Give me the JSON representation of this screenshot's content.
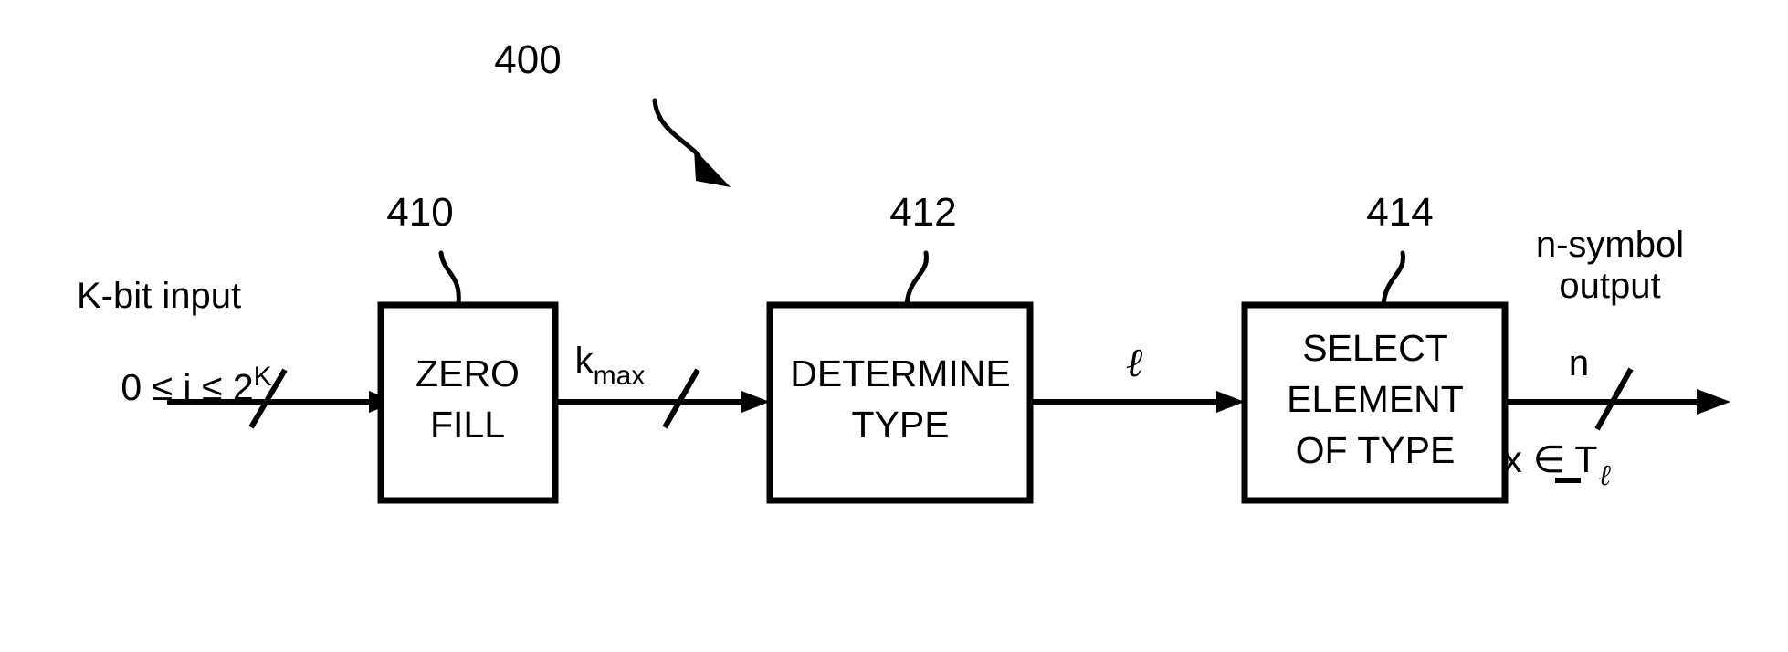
{
  "figure": {
    "figure_number": "400",
    "blocks": [
      {
        "ref": "410",
        "lines": [
          "ZERO",
          "FILL"
        ],
        "name": "zero-fill-block"
      },
      {
        "ref": "412",
        "lines": [
          "DETERMINE",
          "TYPE"
        ],
        "name": "determine-type-block"
      },
      {
        "ref": "414",
        "lines": [
          "SELECT",
          "ELEMENT",
          "OF TYPE"
        ],
        "name": "select-element-of-type-block"
      }
    ],
    "input": {
      "label": "K-bit input",
      "constraint_lhs": "0 ≤ i ≤ 2",
      "constraint_exp": "K",
      "has_slash": true
    },
    "signals": [
      {
        "name": "kmax",
        "base": "k",
        "subscript": "max",
        "has_slash": true
      },
      {
        "name": "ell",
        "base": "ℓ",
        "subscript": "",
        "has_slash": false
      }
    ],
    "output": {
      "caption_line1": "n-symbol",
      "caption_line2": "output",
      "width_label": "n",
      "has_slash": true,
      "set_member_var": "x",
      "set_member_op": "∈",
      "set_member_set": "T",
      "set_member_sub": "ℓ"
    },
    "colors": {
      "ink": "#000000",
      "background": "#ffffff"
    }
  }
}
